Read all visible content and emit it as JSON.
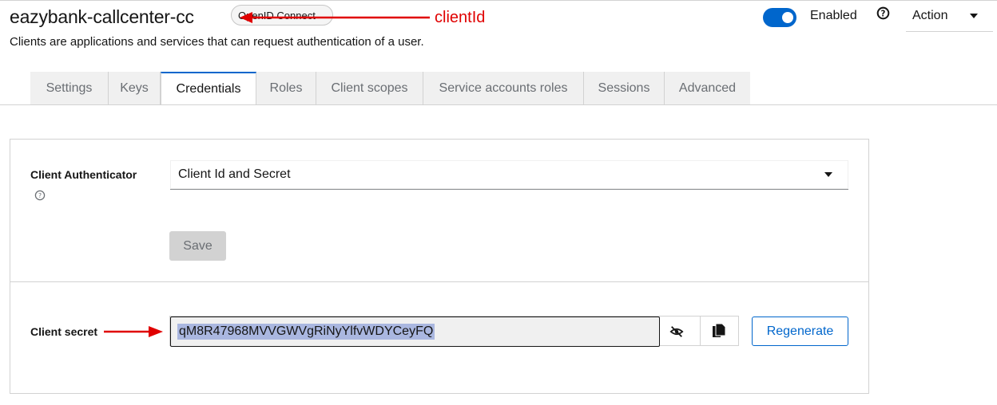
{
  "header": {
    "title": "eazybank-callcenter-cc",
    "protocol_badge": "OpenID Connect",
    "annotation": "clientId",
    "subtitle": "Clients are applications and services that can request authentication of a user.",
    "enabled_label": "Enabled",
    "enabled": true,
    "action_label": "Action"
  },
  "tabs": [
    {
      "label": "Settings",
      "active": false
    },
    {
      "label": "Keys",
      "active": false
    },
    {
      "label": "Credentials",
      "active": true
    },
    {
      "label": "Roles",
      "active": false
    },
    {
      "label": "Client scopes",
      "active": false
    },
    {
      "label": "Service accounts roles",
      "active": false
    },
    {
      "label": "Sessions",
      "active": false
    },
    {
      "label": "Advanced",
      "active": false
    }
  ],
  "credentials": {
    "authenticator_label": "Client Authenticator",
    "authenticator_value": "Client Id and Secret",
    "save_label": "Save",
    "secret_label": "Client secret",
    "secret_value": "qM8R47968MVVGWVgRiNyYlfvWDYCeyFQ",
    "regenerate_label": "Regenerate"
  },
  "colors": {
    "accent": "#0066cc",
    "annotation": "#e00000"
  }
}
